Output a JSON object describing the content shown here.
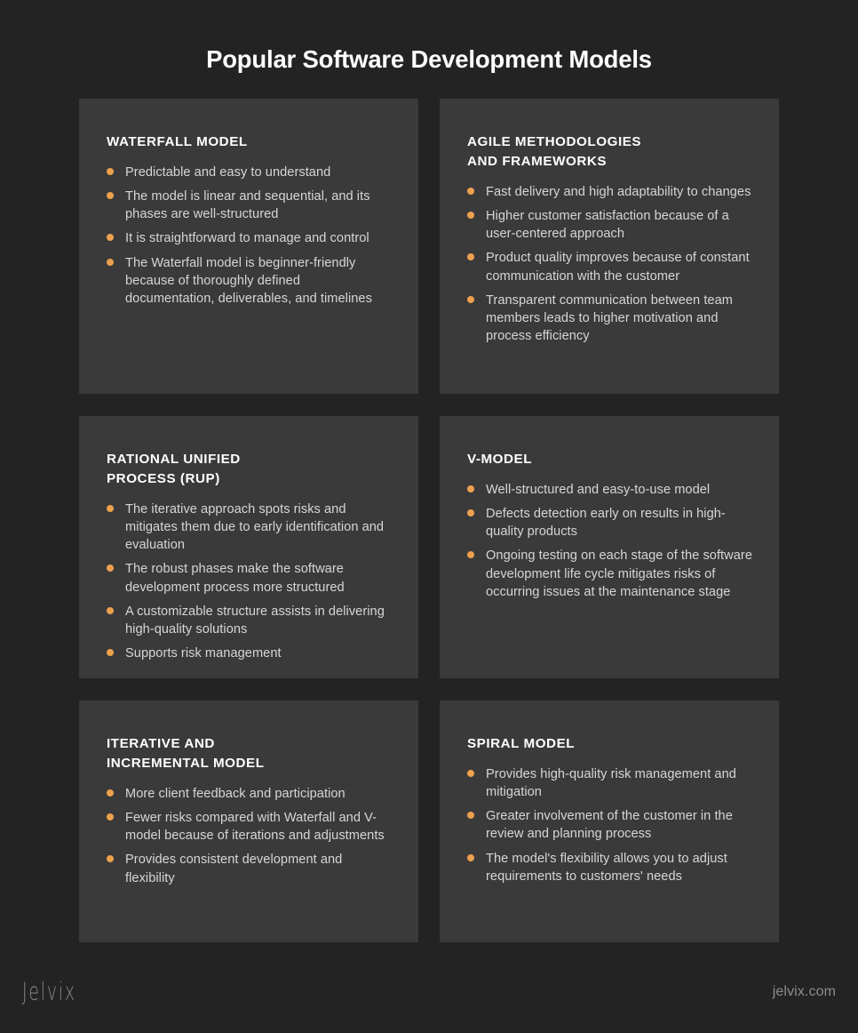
{
  "header": {
    "title": "Popular Software Development Models"
  },
  "theme": {
    "page_background": "#232323",
    "card_background": "#3a3a3a",
    "bullet_color": "#eda14e",
    "title_color": "#ffffff",
    "body_text_color": "#d6d6d6",
    "footer_text_color": "#8a8a8a"
  },
  "cards": [
    {
      "title": "WATERFALL MODEL",
      "bullets": [
        "Predictable and easy to understand",
        "The model is linear and sequential, and its phases are well-structured",
        "It is straightforward to manage and control",
        "The Waterfall model is beginner-friendly because of thoroughly defined documentation, deliverables, and timelines"
      ]
    },
    {
      "title": "AGILE METHODOLOGIES\nAND FRAMEWORKS",
      "bullets": [
        "Fast delivery and high adaptability to changes",
        "Higher customer satisfaction because of a user-centered approach",
        "Product quality improves because of constant communication with the customer",
        "Transparent communication between team members leads to higher motivation and process efficiency"
      ]
    },
    {
      "title": "RATIONAL UNIFIED\nPROCESS (RUP)",
      "bullets": [
        "The iterative approach spots risks and mitigates them due to early identification and evaluation",
        "The robust phases make the software development process more structured",
        "A customizable structure assists in delivering high-quality solutions",
        "Supports risk management"
      ]
    },
    {
      "title": "V-MODEL",
      "bullets": [
        "Well-structured and easy-to-use model",
        "Defects detection early on results in high-quality products",
        "Ongoing testing on each stage of the software development life cycle mitigates risks of occurring issues at the maintenance stage"
      ]
    },
    {
      "title": "ITERATIVE AND\nINCREMENTAL MODEL",
      "bullets": [
        "More client feedback and participation",
        "Fewer risks compared with Waterfall and V-model because of iterations and adjustments",
        "Provides consistent development and flexibility"
      ]
    },
    {
      "title": "SPIRAL MODEL",
      "bullets": [
        "Provides high-quality risk management and mitigation",
        "Greater involvement of the customer in the review and planning process",
        "The model's flexibility allows you to adjust requirements to customers' needs"
      ]
    }
  ],
  "footer": {
    "logo": "Jelvix",
    "website": "jelvix.com"
  }
}
